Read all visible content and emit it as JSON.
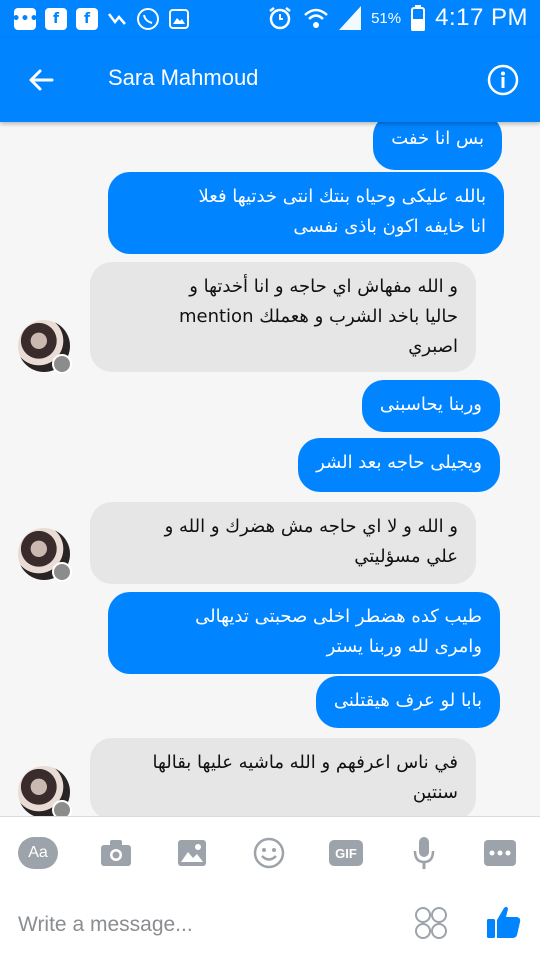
{
  "status_bar": {
    "left_icons": [
      "chat-icon",
      "facebook-icon",
      "facebook-icon",
      "messenger-icon",
      "whatsapp-icon",
      "gallery-icon"
    ],
    "battery": "51%",
    "time": "4:17 PM"
  },
  "header": {
    "title": "Sara Mahmoud",
    "back_icon": "arrow-left-icon",
    "info_icon": "info-icon"
  },
  "messages": [
    {
      "from": "me",
      "text": "بس انا خفت"
    },
    {
      "from": "me",
      "text": "بالله عليكى وحياه بنتك انتى خدتيها فعلا\nانا خايفه اكون باذى نفسى"
    },
    {
      "from": "them",
      "text": "و الله مفهاش اي حاجه و انا أخدتها و\nحاليا باخد الشرب و هعملك mention\nاصبري"
    },
    {
      "from": "me",
      "text": "وربنا يحاسبنى"
    },
    {
      "from": "me",
      "text": "ويجيلى حاجه بعد الشر"
    },
    {
      "from": "them",
      "text": "و الله و لا اي حاجه مش هضرك و الله و\nعلي مسؤليتي"
    },
    {
      "from": "me",
      "text": "طيب كده هضطر اخلى صحبتى تديهالى\nوامرى لله وربنا يستر"
    },
    {
      "from": "me",
      "text": "بابا لو عرف هيقتلنى"
    },
    {
      "from": "them",
      "text": "في ناس اعرفهم و الله ماشيه عليها بقالها\nسنتين"
    }
  ],
  "toolbar": {
    "aa_label": "Aa",
    "gif_label": "GIF"
  },
  "composer": {
    "placeholder": "Write a message..."
  },
  "colors": {
    "accent": "#0084ff",
    "incoming_bubble": "#e6e6e6",
    "thread_bg": "#f6f6f6"
  }
}
